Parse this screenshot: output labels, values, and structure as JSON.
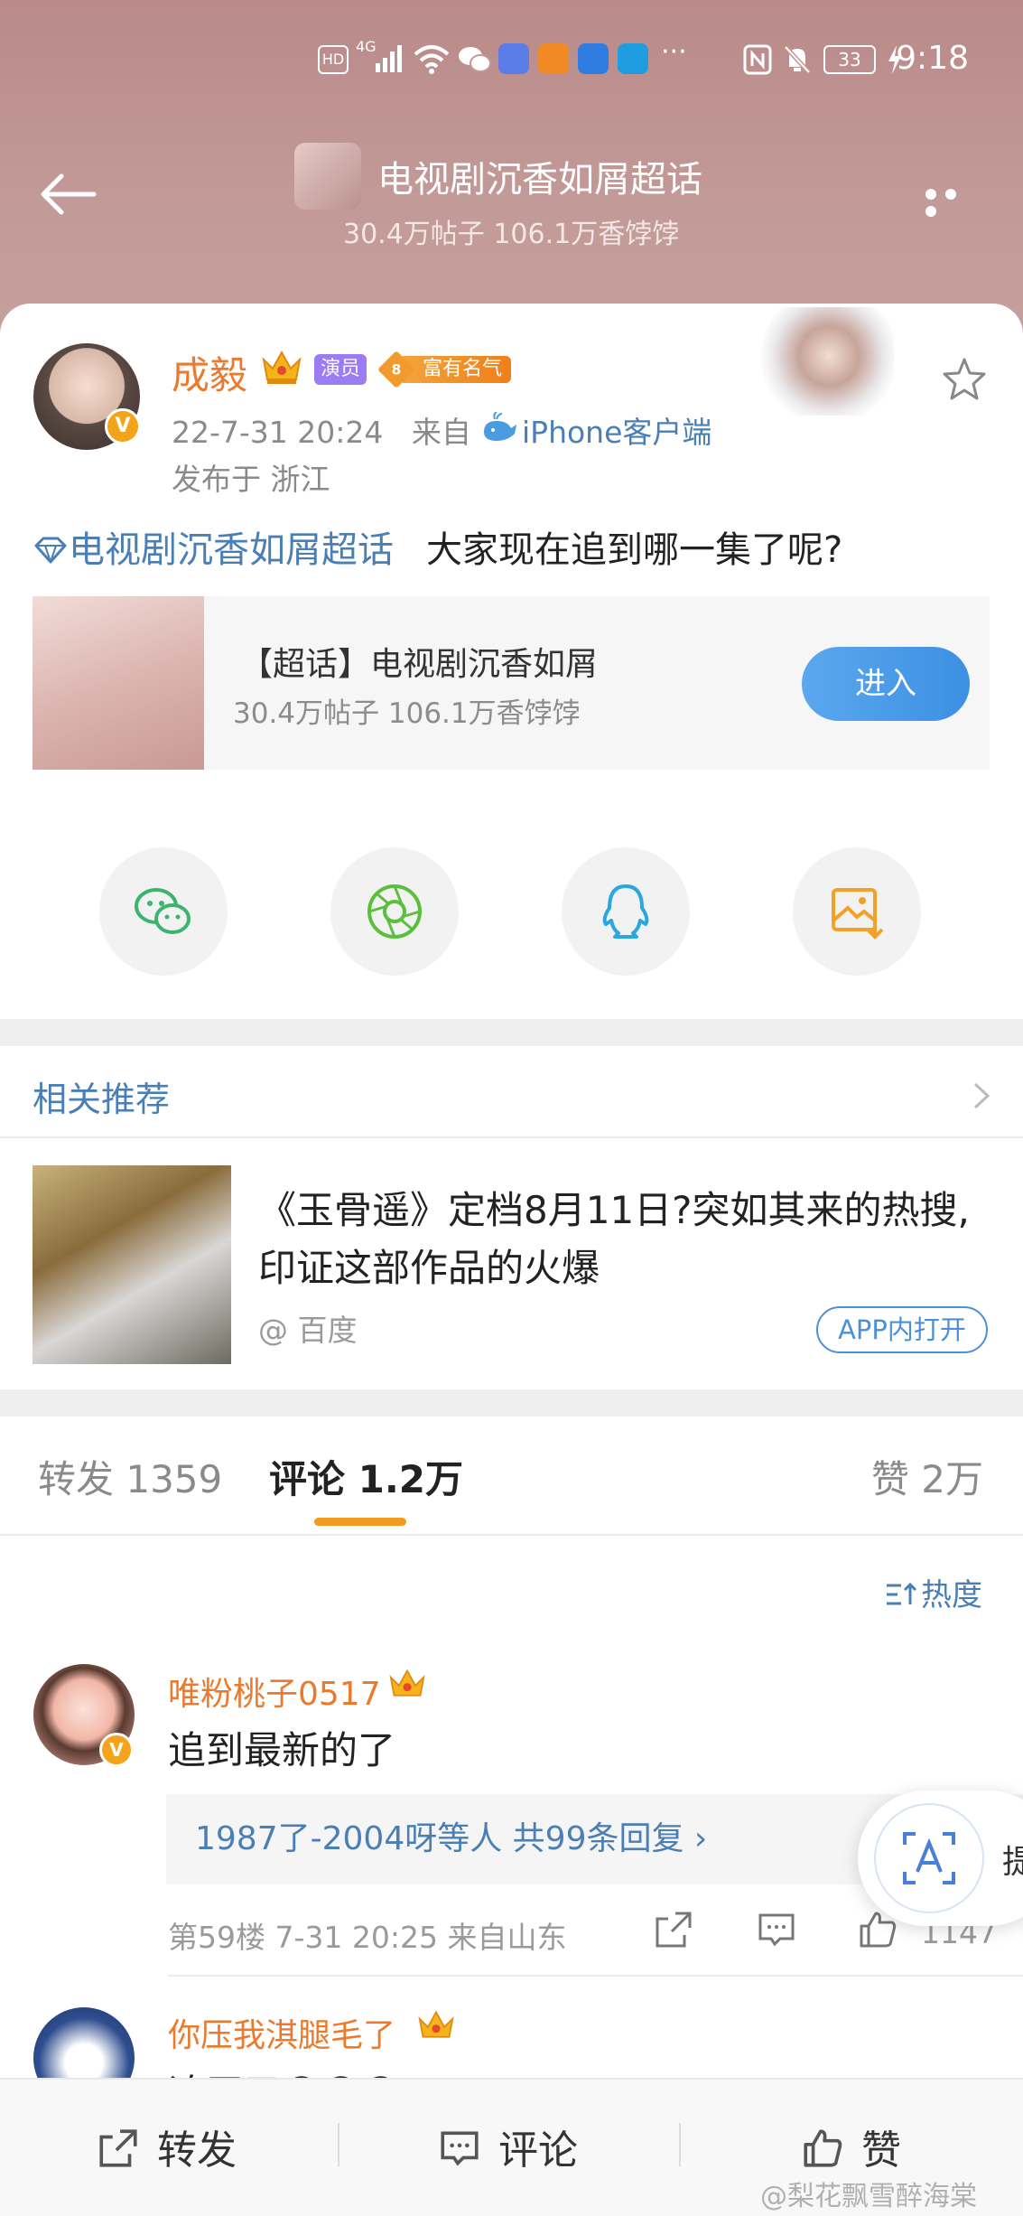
{
  "status_bar": {
    "hd": "HD",
    "network": "4G",
    "battery": "33",
    "time": "9:18",
    "more": "···"
  },
  "header": {
    "title": "电视剧沉香如屑超话",
    "subtitle": "30.4万帖子 106.1万香饽饽"
  },
  "post": {
    "username": "成毅",
    "role_badge": "演员",
    "fame_level": "8",
    "fame_label": "富有名气",
    "time": "22-7-31 20:24",
    "source_prefix": "来自",
    "source": "iPhone客户端",
    "location": "发布于 浙江",
    "topic_link": "电视剧沉香如屑超话",
    "text": "大家现在追到哪一集了呢?",
    "avatar_badge": "V"
  },
  "topic_card": {
    "title": "【超话】电视剧沉香如屑",
    "stats": "30.4万帖子 106.1万香饽饽",
    "enter_label": "进入"
  },
  "share_icons": [
    "wechat-icon",
    "moments-icon",
    "qq-icon",
    "save-image-icon"
  ],
  "recommend": {
    "header": "相关推荐",
    "title": "《玉骨遥》定档8月11日?突如其来的热搜,印证这部作品的火爆",
    "source": "@ 百度",
    "app_open_label": "APP内打开"
  },
  "tabs": {
    "forward": "转发 1359",
    "comments": "评论 1.2万",
    "likes": "赞 2万"
  },
  "sort_label": "热度",
  "comments": [
    {
      "name": "唯粉桃子0517",
      "text": "追到最新的了",
      "replies": "1987了-2004呀等人  共99条回复 ›",
      "meta": "第59楼 7-31 20:25 来自山东",
      "likes": "1147"
    },
    {
      "name": "你压我淇腿毛了",
      "text": "追平了😊😊😊"
    }
  ],
  "float_label": "提",
  "bottom_bar": {
    "forward": "转发",
    "comment": "评论",
    "like": "赞",
    "watermark": "@梨花飘雪醉海棠"
  },
  "colors": {
    "header_bg": "#c29a97",
    "accent_blue": "#4a7fb5",
    "name_orange": "#eb7a2c",
    "tab_indicator": "#f29b22",
    "enter_button": "#3c8fe2"
  }
}
